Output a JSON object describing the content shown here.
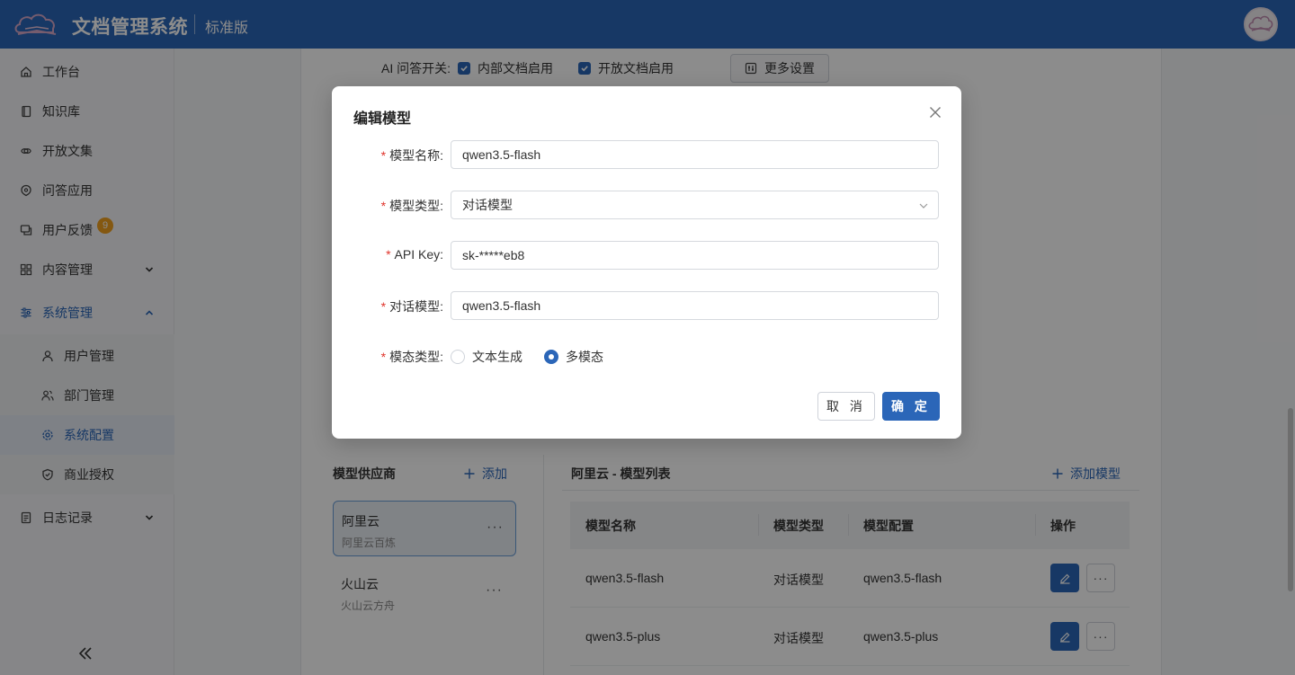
{
  "header": {
    "app_title": "文档管理系统",
    "edition": "标准版"
  },
  "sidebar": {
    "items": [
      {
        "label": "工作台",
        "icon": "home-icon"
      },
      {
        "label": "知识库",
        "icon": "book-icon"
      },
      {
        "label": "开放文集",
        "icon": "link-icon"
      },
      {
        "label": "问答应用",
        "icon": "ai-app-icon"
      },
      {
        "label": "用户反馈",
        "icon": "feedback-icon",
        "badge": "9"
      },
      {
        "label": "内容管理",
        "icon": "grid-icon"
      },
      {
        "label": "系统管理",
        "icon": "sliders-icon"
      },
      {
        "label": "用户管理",
        "icon": "user-icon"
      },
      {
        "label": "部门管理",
        "icon": "users-icon"
      },
      {
        "label": "系统配置",
        "icon": "gear-icon"
      },
      {
        "label": "商业授权",
        "icon": "shield-icon"
      },
      {
        "label": "日志记录",
        "icon": "log-icon"
      }
    ]
  },
  "settings": {
    "ai_label": "AI 问答开关:",
    "internal_docs": "内部文档启用",
    "open_docs": "开放文档启用",
    "more_settings": "更多设置"
  },
  "providers": {
    "title": "模型供应商",
    "add": "添加",
    "items": [
      {
        "name": "阿里云",
        "desc": "阿里云百炼",
        "selected": true
      },
      {
        "name": "火山云",
        "desc": "火山云方舟",
        "selected": false
      }
    ]
  },
  "model_list": {
    "title": "阿里云 - 模型列表",
    "add": "添加模型",
    "columns": [
      "模型名称",
      "模型类型",
      "模型配置",
      "操作"
    ],
    "rows": [
      {
        "name": "qwen3.5-flash",
        "type": "对话模型",
        "config": "qwen3.5-flash"
      },
      {
        "name": "qwen3.5-plus",
        "type": "对话模型",
        "config": "qwen3.5-plus"
      }
    ]
  },
  "modal": {
    "title": "编辑模型",
    "fields": {
      "name": {
        "label": "模型名称:",
        "value": "qwen3.5-flash"
      },
      "type": {
        "label": "模型类型:",
        "value": "对话模型"
      },
      "api_key": {
        "label": "API Key:",
        "value": "sk-*****eb8"
      },
      "chat_model": {
        "label": "对话模型:",
        "value": "qwen3.5-flash"
      },
      "modality": {
        "label": "模态类型:",
        "options": [
          "文本生成",
          "多模态"
        ],
        "selected": "多模态"
      }
    },
    "cancel": "取 消",
    "confirm": "确 定"
  },
  "colors": {
    "primary": "#2b66b8",
    "required": "#e0342b",
    "badge": "#f0a020"
  }
}
